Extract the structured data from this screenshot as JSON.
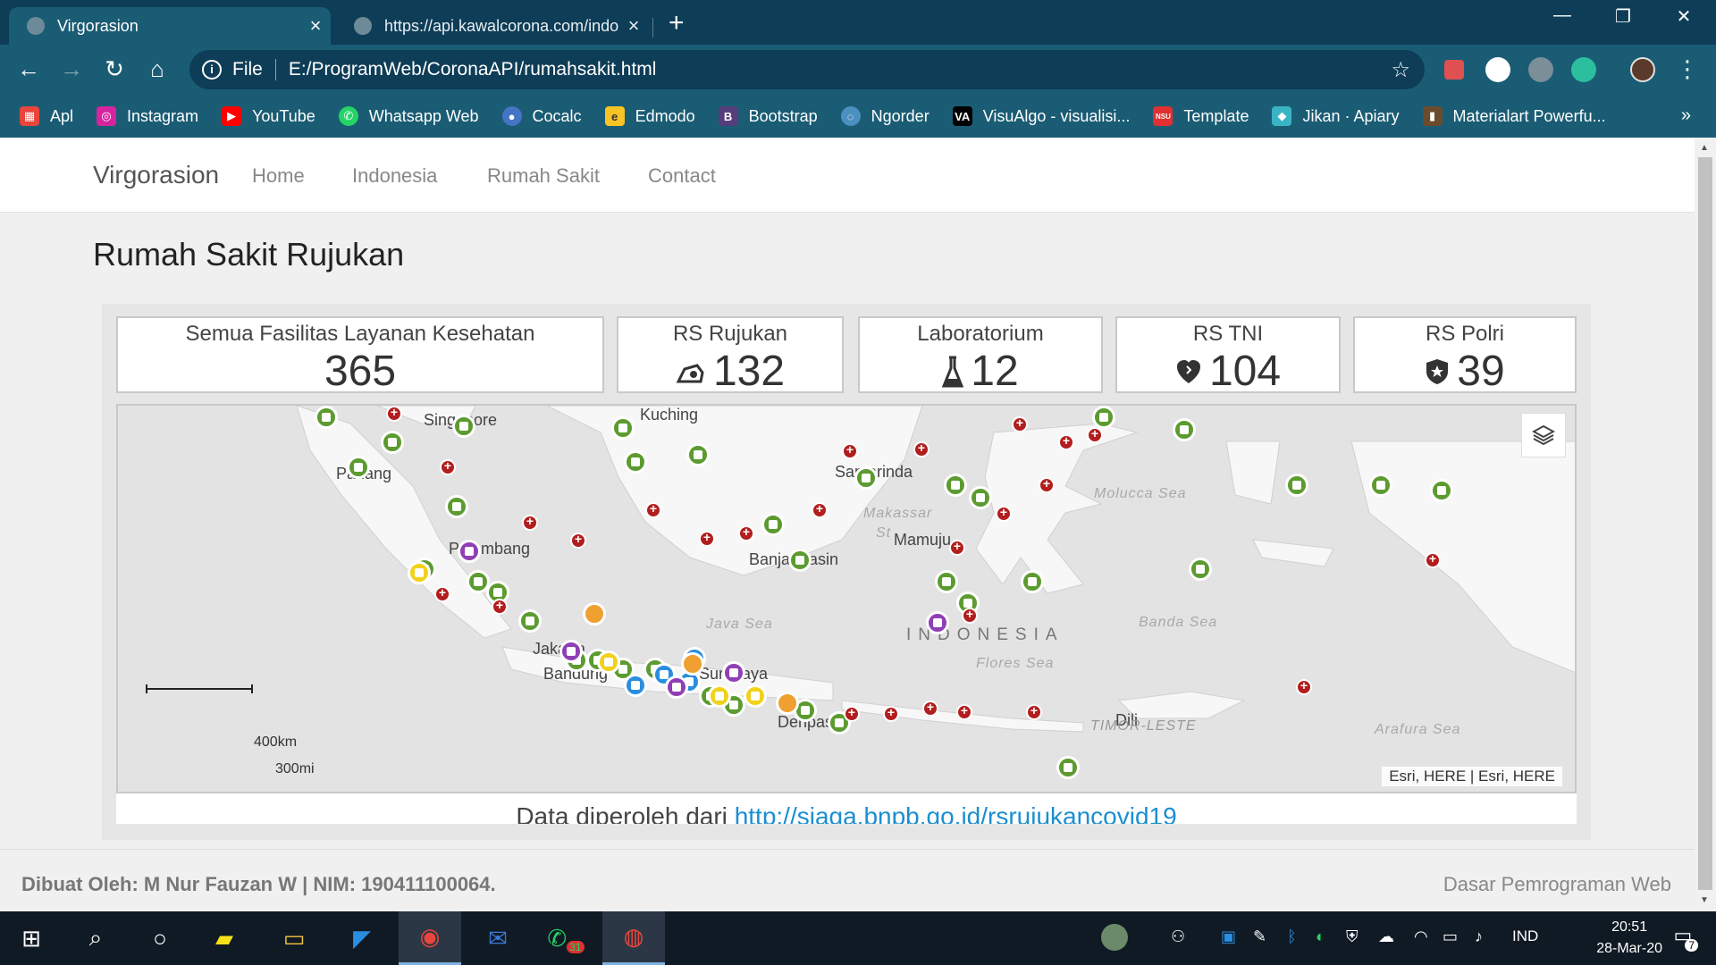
{
  "browser": {
    "tabs": [
      {
        "title": "Virgorasion",
        "active": true
      },
      {
        "title": "https://api.kawalcorona.com/indo",
        "active": false
      }
    ],
    "new_tab": "+",
    "window_controls": {
      "minimize": "—",
      "maximize": "❐",
      "close": "✕"
    },
    "omnibox": {
      "scheme_label": "File",
      "url": "E:/ProgramWeb/CoronaAPI/rumahsakit.html"
    },
    "bookmarks": [
      {
        "label": "Apl",
        "icon": "apps-grid-icon",
        "color": "#e8453c"
      },
      {
        "label": "Instagram",
        "icon": "instagram-icon",
        "color": "#d6249f"
      },
      {
        "label": "YouTube",
        "icon": "youtube-icon",
        "color": "#ff0000"
      },
      {
        "label": "Whatsapp Web",
        "icon": "whatsapp-icon",
        "color": "#25d366"
      },
      {
        "label": "Cocalc",
        "icon": "cocalc-icon",
        "color": "#4474c4"
      },
      {
        "label": "Edmodo",
        "icon": "edmodo-icon",
        "color": "#f7c325"
      },
      {
        "label": "Bootstrap",
        "icon": "bootstrap-icon",
        "color": "#563d7c"
      },
      {
        "label": "Ngorder",
        "icon": "ngorder-icon",
        "color": "#4a90c0"
      },
      {
        "label": "VisuAlgo - visualisi...",
        "icon": "visualgo-icon",
        "color": "#000000"
      },
      {
        "label": "Template",
        "icon": "template-icon",
        "color": "#e03030"
      },
      {
        "label": "Jikan · Apiary",
        "icon": "apiary-icon",
        "color": "#3ab4c4"
      },
      {
        "label": "Materialart Powerfu...",
        "icon": "materialart-icon",
        "color": "#6b4b2b"
      }
    ],
    "bookmarks_more": "»"
  },
  "navbar": {
    "brand": "Virgorasion",
    "links": [
      "Home",
      "Indonesia",
      "Rumah Sakit",
      "Contact"
    ]
  },
  "page_title": "Rumah Sakit Rujukan",
  "stats": [
    {
      "label": "Semua Fasilitas Layanan Kesehatan",
      "value": "365",
      "icon": ""
    },
    {
      "label": "RS Rujukan",
      "value": "132",
      "icon": "ambulance-icon"
    },
    {
      "label": "Laboratorium",
      "value": "12",
      "icon": "flask-icon"
    },
    {
      "label": "RS TNI",
      "value": "104",
      "icon": "heart-shield-icon"
    },
    {
      "label": "RS Polri",
      "value": "39",
      "icon": "star-shield-icon"
    }
  ],
  "map": {
    "cities": [
      "Singapore",
      "Kuching",
      "Padang",
      "Palembang",
      "Samarinda",
      "Banjarmasin",
      "Mamuju",
      "Jakarta",
      "Bandung",
      "Surabaya",
      "Denpasar",
      "Dili"
    ],
    "seas": [
      "Makassar Strait",
      "Molucca Sea",
      "Java Sea",
      "Flores Sea",
      "Banda Sea",
      "Arafura Sea"
    ],
    "sea_display": [
      "Makassar",
      "St",
      "Molucca Sea",
      "Java Sea",
      "Flores Sea",
      "Banda Sea",
      "Arafura Sea"
    ],
    "country": "INDONESIA",
    "region": "TIMOR-LESTE",
    "scale_km": "400km",
    "scale_mi": "300mi",
    "attribution": "Esri, HERE | Esri, HERE",
    "source_prefix": "Data diperoleh dari",
    "source_link": "http://siaga.bnpb.go.id/rsrujukancovid19"
  },
  "footer": {
    "credit": "Dibuat Oleh: M Nur Fauzan W | NIM: 190411100064.",
    "course": "Dasar Pemrograman Web"
  },
  "taskbar": {
    "language": "IND",
    "time": "20:51",
    "date": "28-Mar-20",
    "mail_badge": "31",
    "notification_count": "7"
  }
}
